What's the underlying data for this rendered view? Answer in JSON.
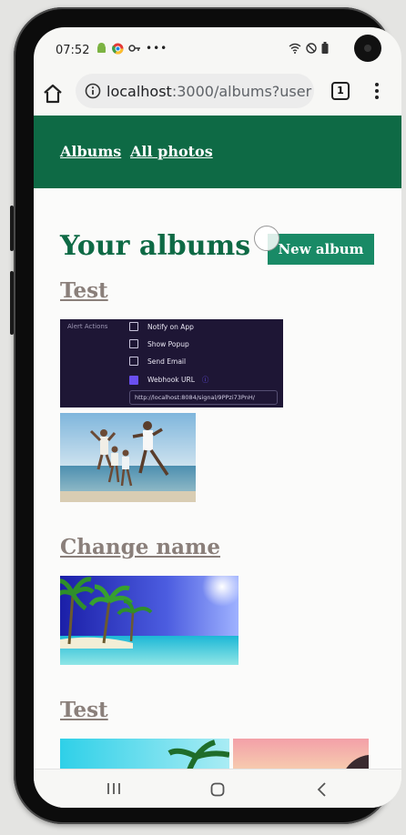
{
  "status_bar": {
    "time": "07:52",
    "left_icons": [
      "android-icon",
      "chrome-color-icon",
      "key-icon",
      "more-dots-icon"
    ],
    "right_icons": [
      "wifi-icon",
      "do-not-disturb-icon",
      "battery-icon"
    ]
  },
  "browser": {
    "url_host": "localhost",
    "url_path": ":3000/albums?user",
    "tab_count": "1"
  },
  "site": {
    "nav": {
      "albums": "Albums",
      "all_photos": "All photos"
    },
    "page_title": "Your albums",
    "new_album_button": "New album",
    "albums": [
      {
        "title": "Test"
      },
      {
        "title": "Change name"
      },
      {
        "title": "Test"
      }
    ],
    "screenshot_thumb": {
      "side_label": "Alert Actions",
      "options": [
        "Notify on App",
        "Show Popup",
        "Send Email",
        "Webhook URL"
      ],
      "checked": [
        false,
        false,
        false,
        true
      ],
      "webhook_value": "http://localhost:8084/signal/9PPzi73PnH/"
    }
  },
  "colors": {
    "brand_green": "#0e6a45",
    "button_green": "#198a66",
    "album_link": "#8a7f7a"
  }
}
